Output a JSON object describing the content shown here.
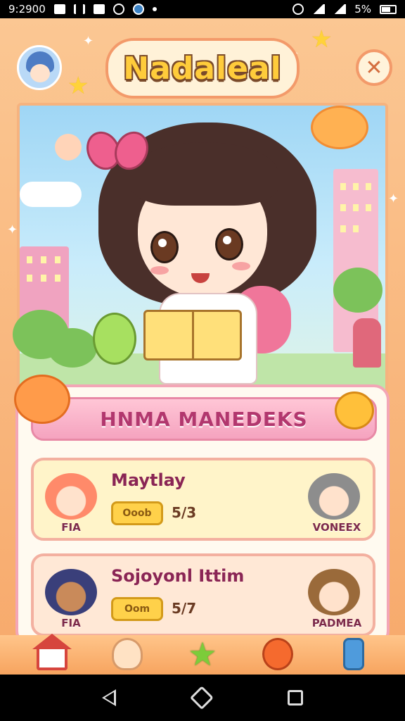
{
  "status_bar": {
    "time": "9:2900",
    "battery": "5%"
  },
  "app": {
    "title": "Nadaleal",
    "close_icon": "close-icon"
  },
  "scene": {
    "character": "girl-reading-book",
    "icons": [
      "star-icon",
      "sparkle-icon",
      "cloud-icon",
      "building-icon",
      "pet-icon"
    ]
  },
  "panel": {
    "title": "HNMA MANEDEKS",
    "missions": [
      {
        "title": "Maytlay",
        "button_label": "Ooob",
        "count": "5/3",
        "left_avatar_label": "FIA",
        "right_avatar_label": "VONEEX"
      },
      {
        "title": "Sojoyonl Ittim",
        "button_label": "Oom",
        "count": "5/7",
        "left_avatar_label": "FIA",
        "right_avatar_label": "PADMEA"
      }
    ]
  },
  "tabbar": {
    "tabs": [
      {
        "icon": "home-icon"
      },
      {
        "icon": "bunny-icon"
      },
      {
        "icon": "star-icon"
      },
      {
        "icon": "orange-icon"
      },
      {
        "icon": "key-icon"
      }
    ]
  },
  "colors": {
    "frame": "#f7a96b",
    "panel_border": "#f3a6b6",
    "title_text": "#ffcc3b",
    "mission_title": "#8a2555",
    "button": "#ffd14a"
  }
}
